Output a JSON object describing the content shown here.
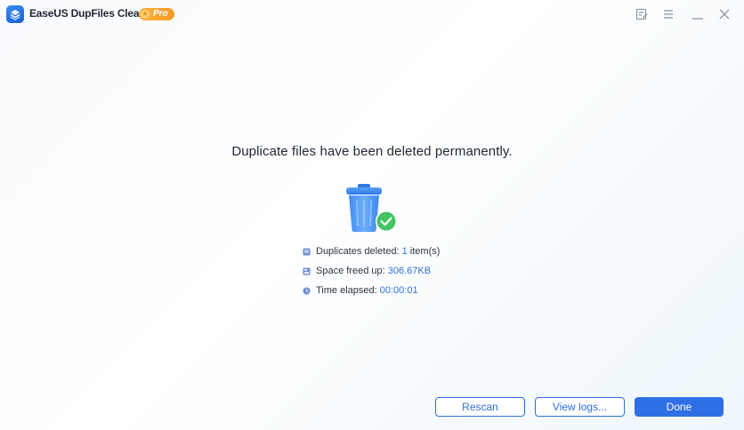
{
  "app": {
    "title": "EaseUS DupFiles Cleaner",
    "badge": "Pro",
    "accent_color": "#2f6fe6"
  },
  "titlebar": {
    "icons": [
      "feedback-icon",
      "menu-icon",
      "minimize-icon",
      "close-icon"
    ]
  },
  "main": {
    "headline": "Duplicate files have been deleted permanently.",
    "illustration": "trash-bin-check-icon",
    "stats": [
      {
        "icon": "file-icon",
        "label": "Duplicates deleted: ",
        "value": "1",
        "suffix": " item(s)"
      },
      {
        "icon": "disk-icon",
        "label": "Space freed up: ",
        "value": "306.67KB",
        "suffix": ""
      },
      {
        "icon": "clock-icon",
        "label": "Time elapsed: ",
        "value": "00:00:01",
        "suffix": ""
      }
    ]
  },
  "footer": {
    "rescan_label": "Rescan",
    "view_logs_label": "View logs...",
    "done_label": "Done"
  }
}
